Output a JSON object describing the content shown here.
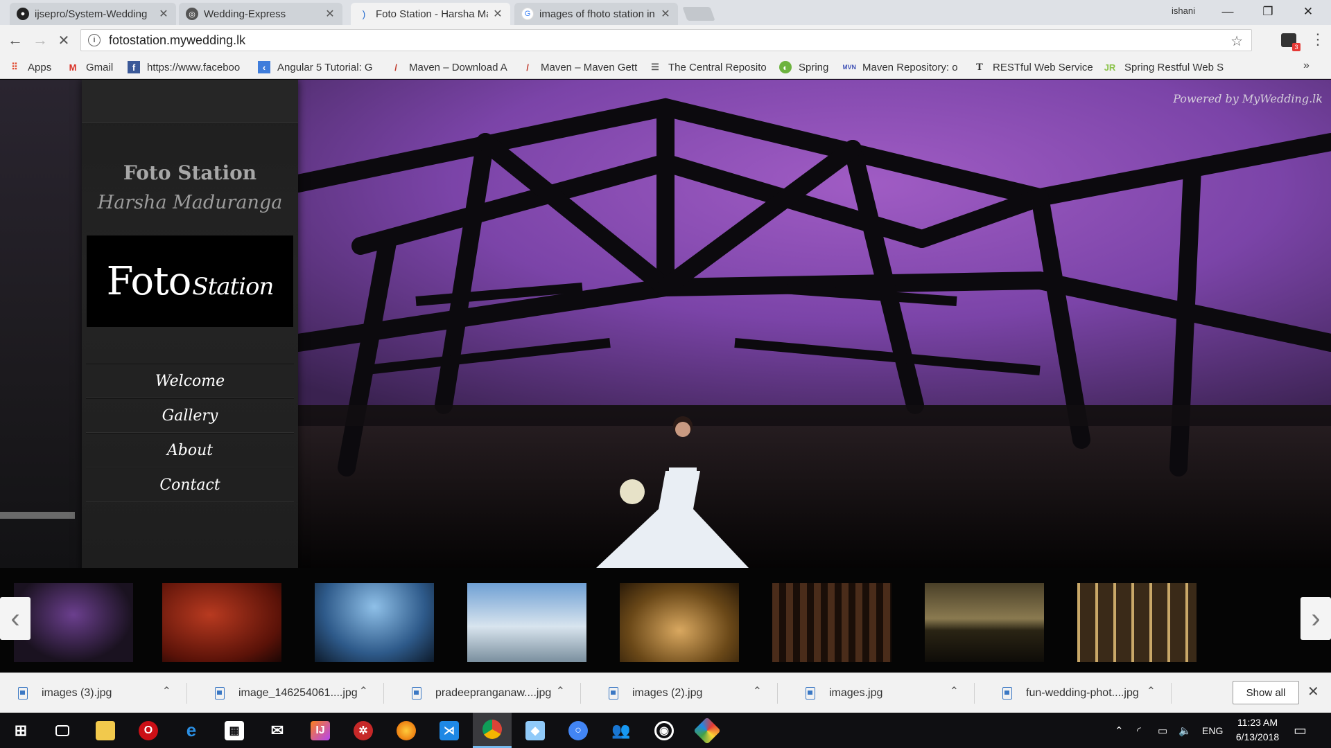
{
  "browser": {
    "tabs": [
      {
        "label": "ijsepro/System-Wedding",
        "icon": "github-icon",
        "active": false
      },
      {
        "label": "Wedding-Express",
        "icon": "repo-icon",
        "active": false
      },
      {
        "label": "Foto Station - Harsha Ma",
        "icon": "loading-icon",
        "active": true
      },
      {
        "label": "images of fhoto station in",
        "icon": "google-icon",
        "active": false
      }
    ],
    "user": "ishani",
    "window_buttons": {
      "minimize": "—",
      "restore": "❐",
      "close": "✕"
    },
    "address": "fotostation.mywedding.lk",
    "bookmarks": [
      {
        "label": "Apps",
        "icon": "apps-grid-icon"
      },
      {
        "label": "Gmail",
        "icon": "gmail-icon"
      },
      {
        "label": "https://www.faceboo",
        "icon": "facebook-icon"
      },
      {
        "label": "Angular 5 Tutorial: G",
        "icon": "angular-icon"
      },
      {
        "label": "Maven – Download A",
        "icon": "maven-icon"
      },
      {
        "label": "Maven – Maven Getti",
        "icon": "maven-icon"
      },
      {
        "label": "The Central Reposito",
        "icon": "repository-icon"
      },
      {
        "label": "Spring",
        "icon": "spring-icon"
      },
      {
        "label": "Maven Repository: o",
        "icon": "mvn-icon"
      },
      {
        "label": "RESTful Web Service",
        "icon": "text-t-icon"
      },
      {
        "label": "Spring Restful Web S",
        "icon": "jr-icon"
      }
    ],
    "bookmarks_more": "»",
    "extension_badge": "3"
  },
  "site": {
    "powered_by": "Powered by MyWedding.lk",
    "brand_title": "Foto Station",
    "brand_subtitle": "Harsha Maduranga",
    "logo": {
      "main": "Foto",
      "script": "Station"
    },
    "nav": [
      "Welcome",
      "Gallery",
      "About",
      "Contact"
    ],
    "thumbnails": [
      "bride-on-bridge-purple",
      "couple-red-sky",
      "couple-fisheye-blue-sky",
      "couple-stupa",
      "group-golden-light",
      "bride-arched-corridor",
      "lake-pier-sunset",
      "couple-sparklers"
    ]
  },
  "downloads": {
    "items": [
      "images (3).jpg",
      "image_146254061....jpg",
      "pradeepranganaw....jpg",
      "images (2).jpg",
      "images.jpg",
      "fun-wedding-phot....jpg"
    ],
    "show_all": "Show all"
  },
  "taskbar": {
    "language": "ENG",
    "time": "11:23 AM",
    "date": "6/13/2018"
  }
}
